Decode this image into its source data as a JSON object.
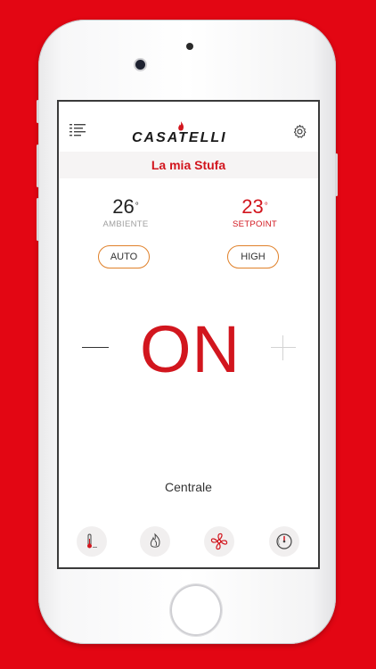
{
  "header": {
    "brand": "CASATELLI",
    "icons": {
      "menu": "menu-list-icon",
      "settings": "gear-icon"
    }
  },
  "title": "La mia Stufa",
  "ambient": {
    "value": "26",
    "unit": "°",
    "label": "AMBIENTE"
  },
  "setpoint": {
    "value": "23",
    "unit": "°",
    "label": "SETPOINT"
  },
  "mode_button": {
    "label": "AUTO"
  },
  "power_level_button": {
    "label": "HIGH"
  },
  "status": "ON",
  "controls": {
    "decrease_icon": "minus-icon",
    "increase_icon": "plus-icon"
  },
  "zone": "Centrale",
  "tabs": [
    {
      "icon": "thermometer-icon"
    },
    {
      "icon": "flame-icon"
    },
    {
      "icon": "fan-icon"
    },
    {
      "icon": "gauge-icon"
    }
  ],
  "colors": {
    "accent": "#d2161e",
    "pill_border": "#e0812a",
    "background": "#e30613"
  }
}
